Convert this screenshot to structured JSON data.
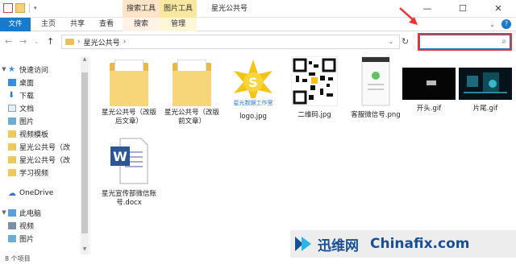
{
  "window": {
    "title": "星光公共号",
    "context_tabs": [
      "搜索工具",
      "图片工具"
    ],
    "controls": [
      "—",
      "☐",
      "✕"
    ]
  },
  "ribbon": {
    "tabs": [
      "文件",
      "主页",
      "共享",
      "查看",
      "搜索",
      "管理"
    ]
  },
  "address": {
    "path": "星光公共号",
    "separator": "›"
  },
  "search": {
    "value": "",
    "placeholder": ""
  },
  "sidebar": {
    "items": [
      {
        "label": "快速访问",
        "icon": "star-icon",
        "level": 0,
        "expanded": true
      },
      {
        "label": "桌面",
        "icon": "desktop-icon",
        "level": 1,
        "pinned": true
      },
      {
        "label": "下载",
        "icon": "download-icon",
        "level": 1,
        "pinned": true
      },
      {
        "label": "文档",
        "icon": "document-icon",
        "level": 1,
        "pinned": true
      },
      {
        "label": "图片",
        "icon": "pictures-icon",
        "level": 1,
        "pinned": true
      },
      {
        "label": "视频模板",
        "icon": "folder-icon",
        "level": 1
      },
      {
        "label": "星光公共号（改",
        "icon": "folder-icon",
        "level": 1
      },
      {
        "label": "星光公共号（改",
        "icon": "folder-icon",
        "level": 1
      },
      {
        "label": "学习视频",
        "icon": "folder-icon",
        "level": 1
      },
      {
        "label": "OneDrive",
        "icon": "cloud-icon",
        "level": 0
      },
      {
        "label": "此电脑",
        "icon": "computer-icon",
        "level": 0,
        "expanded": true
      },
      {
        "label": "视频",
        "icon": "video-icon",
        "level": 1
      },
      {
        "label": "图片",
        "icon": "pictures-icon",
        "level": 1
      }
    ]
  },
  "files": [
    {
      "name": "星光公共号（改版后文章）",
      "type": "folder"
    },
    {
      "name": "星光公共号（改版前文章）",
      "type": "folder"
    },
    {
      "name": "logo.jpg",
      "type": "logo",
      "logo_text": "S",
      "caption_text": "星光数据工作室"
    },
    {
      "name": "二维码.jpg",
      "type": "qrcode"
    },
    {
      "name": "客服微信号.png",
      "type": "phone"
    },
    {
      "name": "开头.gif",
      "type": "dark"
    },
    {
      "name": "片尾.gif",
      "type": "darkcyan"
    },
    {
      "name": "星光宣传部微信账号.docx",
      "type": "word",
      "badge": "W"
    }
  ],
  "status": {
    "count": "8 个项目"
  },
  "watermark": {
    "cn": "迅维网",
    "en": "Chinafix.com"
  },
  "colors": {
    "accent": "#1979ca",
    "highlight": "#e33333",
    "folder": "#f7d67a"
  }
}
